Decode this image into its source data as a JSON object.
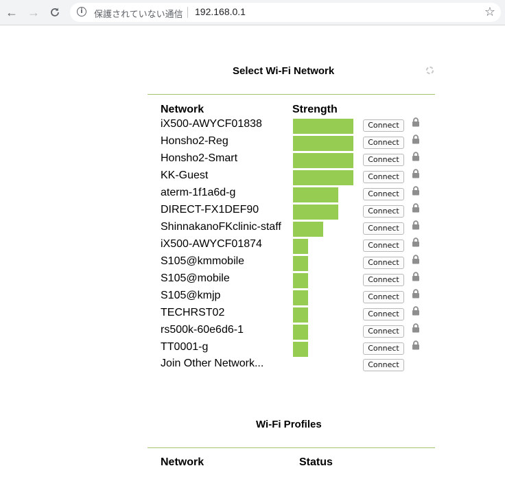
{
  "browser": {
    "security_label": "保護されていない通信",
    "url": "192.168.0.1"
  },
  "scan": {
    "title": "Select Wi-Fi Network",
    "columns": {
      "network": "Network",
      "strength": "Strength"
    },
    "connect_label": "Connect",
    "networks": [
      {
        "name": "iX500-AWYCF01838",
        "strength": 4,
        "secured": true
      },
      {
        "name": "Honsho2-Reg",
        "strength": 4,
        "secured": true
      },
      {
        "name": "Honsho2-Smart",
        "strength": 4,
        "secured": true
      },
      {
        "name": "KK-Guest",
        "strength": 4,
        "secured": true
      },
      {
        "name": "aterm-1f1a6d-g",
        "strength": 3,
        "secured": true
      },
      {
        "name": "DIRECT-FX1DEF90",
        "strength": 3,
        "secured": true
      },
      {
        "name": "ShinnakanoFKclinic-staff",
        "strength": 2,
        "secured": true
      },
      {
        "name": "iX500-AWYCF01874",
        "strength": 1,
        "secured": true
      },
      {
        "name": "S105@kmmobile",
        "strength": 1,
        "secured": true
      },
      {
        "name": "S105@mobile",
        "strength": 1,
        "secured": true
      },
      {
        "name": "S105@kmjp",
        "strength": 1,
        "secured": true
      },
      {
        "name": "TECHRST02",
        "strength": 1,
        "secured": true
      },
      {
        "name": "rs500k-60e6d6-1",
        "strength": 1,
        "secured": true
      },
      {
        "name": "TT0001-g",
        "strength": 1,
        "secured": true
      }
    ],
    "join_other_label": "Join Other Network..."
  },
  "profiles": {
    "title": "Wi-Fi Profiles",
    "columns": {
      "network": "Network",
      "status": "Status"
    }
  },
  "colors": {
    "bar": "#96cc52",
    "rule": "#a3c46d"
  }
}
